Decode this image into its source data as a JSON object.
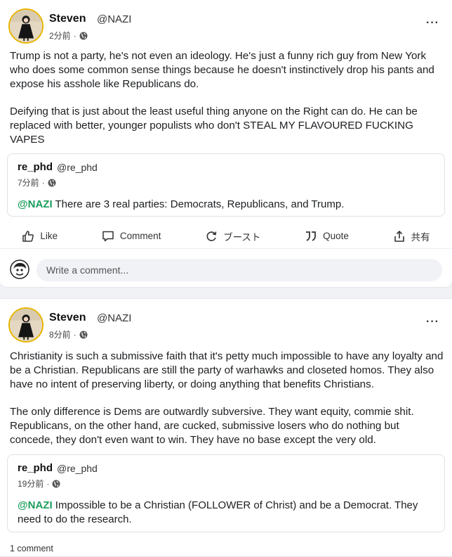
{
  "posts": [
    {
      "author_name": "Steven",
      "author_handle": "@NAZI",
      "time": "2分前",
      "dot": "·",
      "body": [
        "Trump is not a party, he's not even an ideology. He's just a funny rich guy from New York who does some common sense things because he doesn't instinctively drop his pants and expose his asshole like Republicans do.",
        "Deifying that is just about the least useful thing anyone on the Right can do. He can be replaced with better, younger populists who don't STEAL MY FLAVOURED FUCKING VAPES"
      ],
      "quote": {
        "author_name": "re_phd",
        "author_handle": "@re_phd",
        "time": "7分前",
        "dot": "·",
        "mention": "@NAZI",
        "text": " There are 3 real parties: Democrats, Republicans, and Trump."
      },
      "actions": {
        "like": "Like",
        "comment": "Comment",
        "boost": "ブースト",
        "quote": "Quote",
        "share": "共有"
      },
      "comment_placeholder": "Write a comment..."
    },
    {
      "author_name": "Steven",
      "author_handle": "@NAZI",
      "time": "8分前",
      "dot": "·",
      "body": [
        "Christianity is such a submissive faith that it's petty much impossible to have any loyalty and be a Christian. Republicans are still the party of warhawks and closeted homos. They also have no intent of preserving liberty, or doing anything that benefits Christians.",
        "The only difference is Dems are outwardly subversive. They want equity, commie shit. Republicans, on the other hand, are cucked, submissive losers who do nothing but concede, they don't even want to win. They have no base except the very old."
      ],
      "quote": {
        "author_name": "re_phd",
        "author_handle": "@re_phd",
        "time": "19分前",
        "dot": "·",
        "mention": "@NAZI",
        "text": " Impossible to be a Christian (FOLLOWER of Christ) and be a Democrat. They need to do the research."
      },
      "comment_count": "1 comment"
    }
  ],
  "colors": {
    "mention": "#1a9e5c",
    "avatar_ring": "#e8b400"
  },
  "icons": [
    "more-icon",
    "globe-icon",
    "like-icon",
    "comment-icon",
    "boost-icon",
    "quote-icon",
    "share-icon"
  ]
}
